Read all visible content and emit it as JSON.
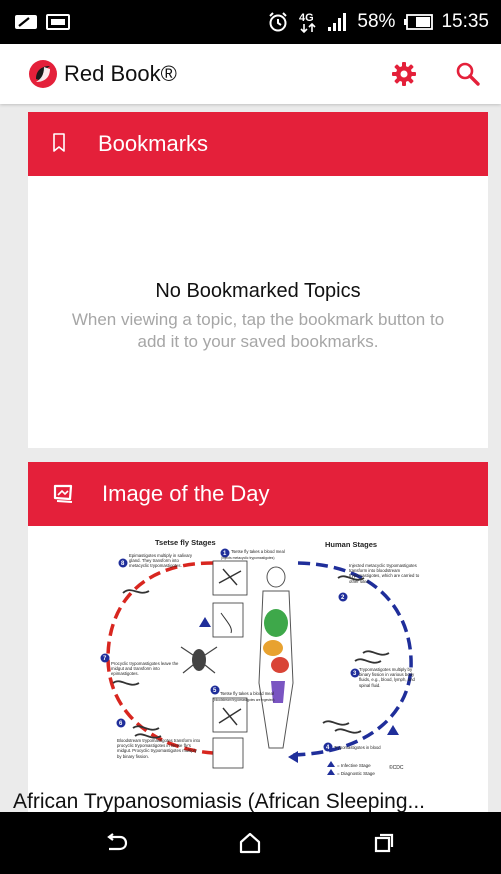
{
  "status_bar": {
    "network": "4G",
    "battery": "58%",
    "time": "15:35",
    "icons": [
      "signal-notification-icon",
      "image-notification-icon",
      "alarm-icon",
      "4g-icon",
      "signal-bars-icon",
      "battery-icon"
    ]
  },
  "app_bar": {
    "title": "Red Book®",
    "icons": [
      "red-book-logo",
      "settings-gear-icon",
      "search-icon"
    ],
    "accent_color": "#e4203a"
  },
  "bookmarks": {
    "header": "Bookmarks",
    "empty_title": "No Bookmarked Topics",
    "empty_description": "When viewing a topic, tap the bookmark button to add it to your saved bookmarks."
  },
  "image_of_the_day": {
    "header": "Image of the Day",
    "caption": "African Trypanosomiasis (African Sleeping...",
    "figure": {
      "tsetse_title": "Tsetse fly Stages",
      "human_title": "Human Stages",
      "step1": "Tsetse fly takes a blood meal",
      "step1_sub": "(injects metacyclic trypomastigotes)",
      "step2": "Injected metacyclic trypomastigotes transform into bloodstream trypomastigotes, which are carried to other sites.",
      "step3": "Trypomastigotes multiply by binary fission in various body fluids, e.g., blood, lymph, and spinal fluid.",
      "step4": "Trypomastigotes in blood",
      "step5": "Tsetse fly takes a blood meal",
      "step5_sub": "(bloodstream trypomastigotes are ingested)",
      "step6": "Bloodstream trypomastigotes transform into procyclic trypomastigotes in tsetse fly's midgut. Procyclic trypomastigotes multiply by binary fission.",
      "step7": "Procyclic trypomastigotes leave the midgut and transform into epimastigotes.",
      "step8": "Epimastigotes multiply in salivary gland. They transform into metacyclic trypomastigotes.",
      "legend_infective": "= Infective Stage",
      "legend_diagnostic": "= Diagnostic Stage",
      "credit": "©CDC"
    }
  },
  "nav_bar": {
    "icons": [
      "back-icon",
      "home-icon",
      "recent-apps-icon"
    ]
  }
}
